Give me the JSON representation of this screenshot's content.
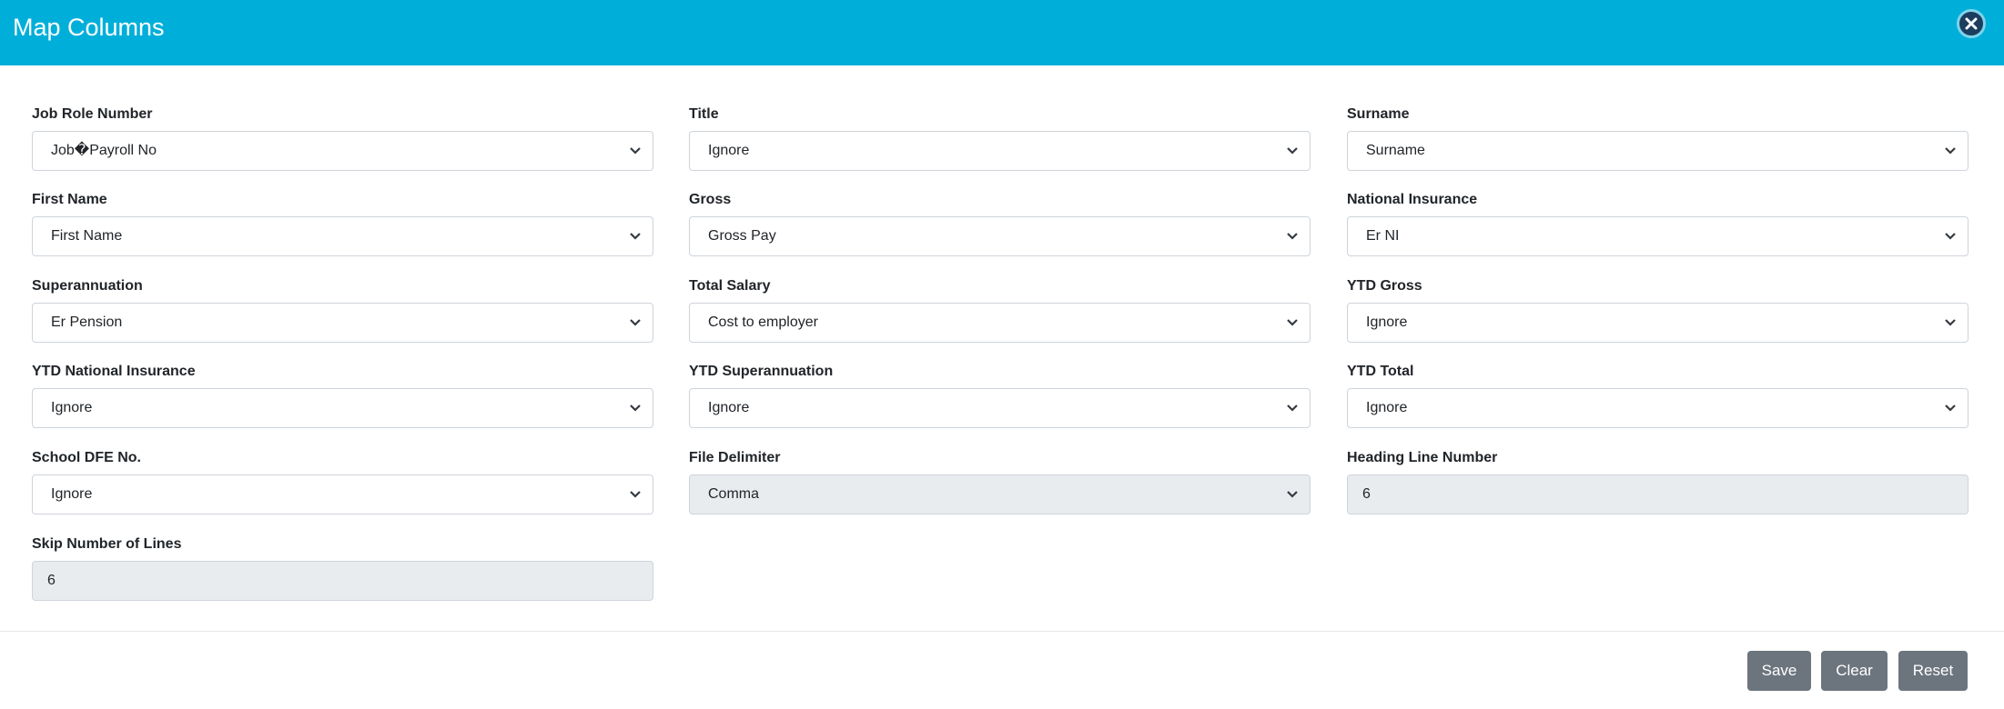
{
  "header": {
    "title": "Map Columns"
  },
  "fields": [
    {
      "label": "Job Role Number",
      "type": "select",
      "value": "Job�Payroll No",
      "disabled": false
    },
    {
      "label": "Title",
      "type": "select",
      "value": "Ignore",
      "disabled": false
    },
    {
      "label": "Surname",
      "type": "select",
      "value": "Surname",
      "disabled": false
    },
    {
      "label": "First Name",
      "type": "select",
      "value": "First Name",
      "disabled": false
    },
    {
      "label": "Gross",
      "type": "select",
      "value": "Gross Pay",
      "disabled": false
    },
    {
      "label": "National Insurance",
      "type": "select",
      "value": "Er NI",
      "disabled": false
    },
    {
      "label": "Superannuation",
      "type": "select",
      "value": "Er Pension",
      "disabled": false
    },
    {
      "label": "Total Salary",
      "type": "select",
      "value": "Cost to employer",
      "disabled": false
    },
    {
      "label": "YTD Gross",
      "type": "select",
      "value": "Ignore",
      "disabled": false
    },
    {
      "label": "YTD National Insurance",
      "type": "select",
      "value": "Ignore",
      "disabled": false
    },
    {
      "label": "YTD Superannuation",
      "type": "select",
      "value": "Ignore",
      "disabled": false
    },
    {
      "label": "YTD Total",
      "type": "select",
      "value": "Ignore",
      "disabled": false
    },
    {
      "label": "School DFE No.",
      "type": "select",
      "value": "Ignore",
      "disabled": false
    },
    {
      "label": "File Delimiter",
      "type": "select",
      "value": "Comma",
      "disabled": true
    },
    {
      "label": "Heading Line Number",
      "type": "input",
      "value": "6",
      "disabled": true
    },
    {
      "label": "Skip Number of Lines",
      "type": "input",
      "value": "6",
      "disabled": true
    }
  ],
  "footer": {
    "save_label": "Save",
    "clear_label": "Clear",
    "reset_label": "Reset"
  },
  "colors": {
    "header_bg": "#00afd9",
    "button_bg": "#6c757d",
    "disabled_bg": "#e9ecef"
  },
  "icons": {
    "close": "close-circle-icon",
    "dropdown": "chevron-down-icon"
  }
}
